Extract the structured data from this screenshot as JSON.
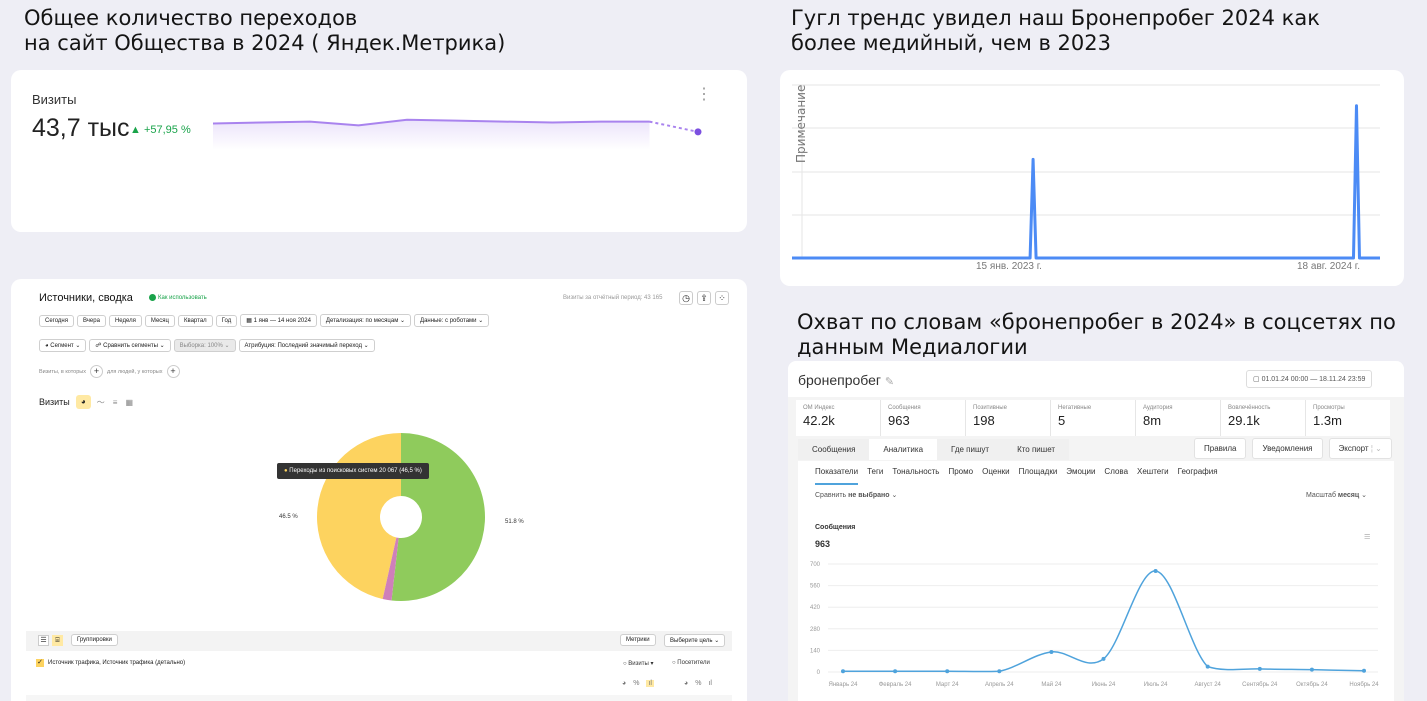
{
  "headings": {
    "metrika_l1": "Общее количество переходов",
    "metrika_l2": "на сайт Общества  в 2024  ( Яндек.Метрика)",
    "trends_l1": "Гугл трендс увидел наш Бронепробег 2024 как",
    "trends_l2": "более медийный, чем в 2023",
    "medialogia_l1": "Охват по словам «бронепробег в 2024» в соцсетях по",
    "medialogia_l2": "данным Медиалогии"
  },
  "visits_card": {
    "label": "Визиты",
    "value": "43,7 тыс",
    "delta": "▲ +57,95 %",
    "menu_icon": "kebab-icon"
  },
  "sources_panel": {
    "title": "Источники, сводка",
    "help_link": "Как использовать",
    "period_info": "Визиты за отчётный период: 43 165",
    "period_buttons": [
      "Сегодня",
      "Вчера",
      "Неделя",
      "Месяц",
      "Квартал",
      "Год"
    ],
    "date_range": "1 янв — 14 ноя 2024",
    "detail": "Детализация: по месяцам",
    "data_mode": "Данные: с роботами",
    "segment": "Сегмент",
    "compare": "Сравнить сегменты",
    "sample": "Выборка: 100%",
    "attribution": "Атрибуция: Последний значимый переход",
    "visits_where": "Визиты, в которых",
    "for_people": "для людей, у которых",
    "chart_label": "Визиты",
    "tooltip": "Переходы из поисковых систем  20 067 (46,5 %)",
    "label_left": "46.5 %",
    "label_right": "51.8 %",
    "groupings": "Группировки",
    "metrics": "Метрики",
    "choose_goal": "Выберите цель",
    "dimension": "Источник трафика, Источник трафика (детально)",
    "col_visits": "Визиты",
    "col_visitors": "Посетители"
  },
  "trends_panel": {
    "y_label": "Примечание",
    "date1": "15 янв. 2023 г.",
    "date2": "18 авг. 2024 г."
  },
  "medialogia": {
    "query": "бронепробег",
    "date_range": "01.01.24 00:00 — 18.11.24 23:59",
    "kpis": [
      {
        "label": "ОМ Индекс",
        "value": "42.2k"
      },
      {
        "label": "Сообщения",
        "value": "963"
      },
      {
        "label": "Позитивные",
        "value": "198"
      },
      {
        "label": "Негативные",
        "value": "5"
      },
      {
        "label": "Аудитория",
        "value": "8m"
      },
      {
        "label": "Вовлечённость",
        "value": "29.1k"
      },
      {
        "label": "Просмотры",
        "value": "1.3m"
      }
    ],
    "tabs": [
      "Сообщения",
      "Аналитика",
      "Где пишут",
      "Кто пишет"
    ],
    "buttons": [
      "Правила",
      "Уведомления",
      "Экспорт"
    ],
    "subtabs": [
      "Показатели",
      "Теги",
      "Тональность",
      "Промо",
      "Оценки",
      "Площадки",
      "Эмоции",
      "Слова",
      "Хештеги",
      "География"
    ],
    "compare_prefix": "Сравнить",
    "compare_value": "не выбрано",
    "scale_prefix": "Масштаб",
    "scale_value": "месяц",
    "chart_title": "Сообщения",
    "chart_total": "963"
  },
  "chart_data": [
    {
      "type": "line",
      "title": "",
      "series": [
        {
          "values": [
            52,
            53,
            54,
            50,
            56,
            55,
            54,
            53,
            54,
            54,
            43
          ]
        }
      ],
      "color": "#a983ee"
    },
    {
      "type": "pie",
      "labels": [
        "Переходы из поисковых систем",
        "Другие источники",
        "Прочие"
      ],
      "values": [
        46.5,
        51.8,
        1.7
      ],
      "colors": [
        "#fdd35f",
        "#8fcb5c",
        "#cf7fba"
      ]
    },
    {
      "type": "line",
      "title": "",
      "xlabel": "",
      "ylabel": "Примечание",
      "x_ticks": [
        "15 янв. 2023 г.",
        "18 авг. 2024 г."
      ],
      "spikes": [
        {
          "position": 0.41,
          "value": 0.57
        },
        {
          "position": 0.96,
          "value": 0.88
        }
      ],
      "color": "#4c8bf5"
    },
    {
      "type": "line",
      "title": "Сообщения",
      "categories": [
        "Январь 24",
        "Февраль 24",
        "Март 24",
        "Апрель 24",
        "Май 24",
        "Июнь 24",
        "Июль 24",
        "Август 24",
        "Сентябрь 24",
        "Октябрь 24",
        "Ноябрь 24"
      ],
      "series": [
        {
          "name": "Сообщения",
          "values": [
            5,
            5,
            5,
            5,
            130,
            85,
            655,
            35,
            20,
            15,
            8
          ]
        }
      ],
      "y_ticks": [
        0,
        140,
        280,
        420,
        560,
        700
      ],
      "ylim": [
        0,
        700
      ],
      "color": "#4fa3dc"
    }
  ]
}
